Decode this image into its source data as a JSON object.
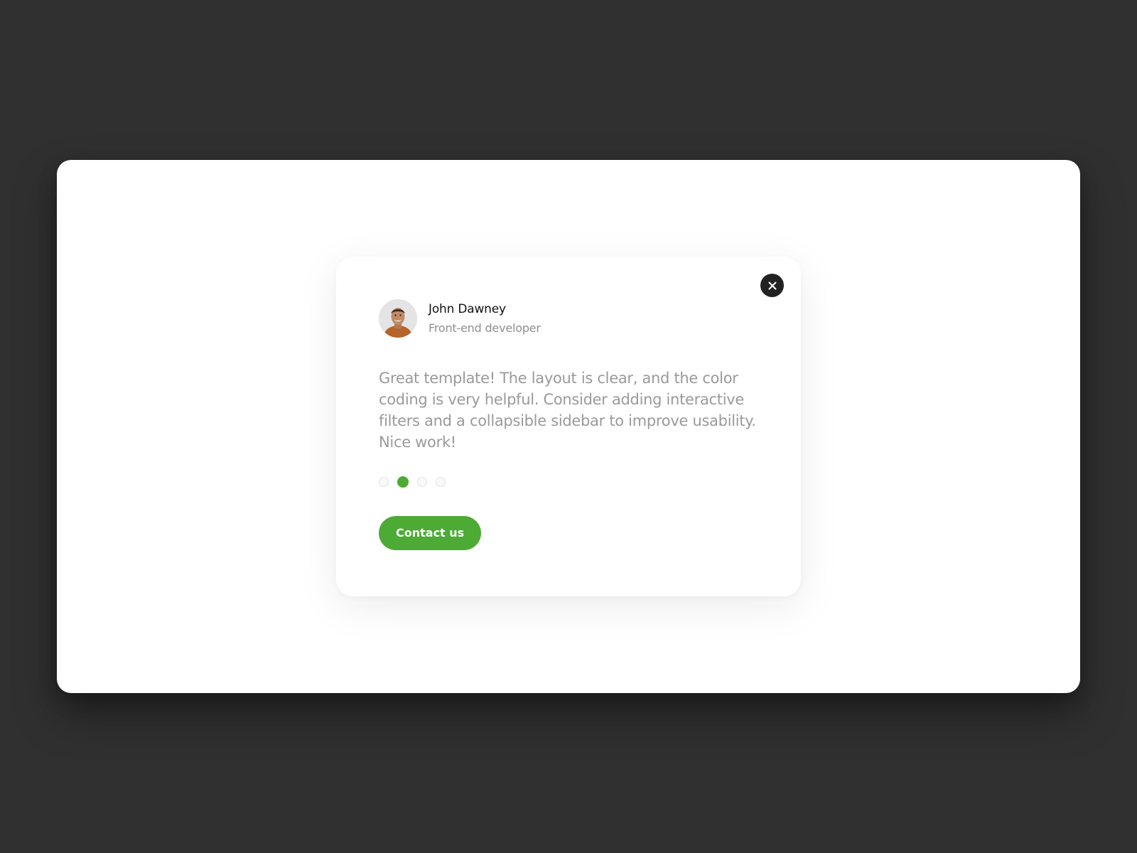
{
  "colors": {
    "page_background": "#303030",
    "frame_background": "#ffffff",
    "accent": "#4caa35",
    "close_button": "#222222",
    "muted_text": "#9a9a9a"
  },
  "testimonial": {
    "author": {
      "name": "John Dawney",
      "role": "Front-end developer",
      "avatar_icon": "person-photo"
    },
    "quote": "Great template! The layout is clear, and the color coding is very helpful. Consider adding interactive filters and a collapsible sidebar to improve usability. Nice work!",
    "close_icon": "close-icon"
  },
  "pagination": {
    "total": 4,
    "active_index": 1
  },
  "cta": {
    "label": "Contact us"
  }
}
